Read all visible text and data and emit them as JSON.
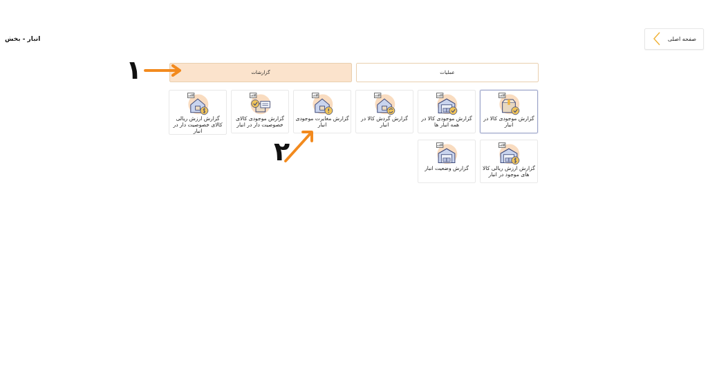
{
  "header": {
    "section_title": "انبار - بخش",
    "home_button": "صفحه اصلی"
  },
  "tabs": [
    {
      "label": "عملیات",
      "selected": false
    },
    {
      "label": "گزارشات",
      "selected": true
    }
  ],
  "tiles": [
    {
      "label": "گزارش موجودی کالا در انبار",
      "kind": "box-check",
      "selected": true
    },
    {
      "label": "گزارش موجودی کالا در همه انبار ها",
      "kind": "warehouse-check",
      "selected": false
    },
    {
      "label": "گزارش گردش کالا در انبار",
      "kind": "house-cycle",
      "selected": false
    },
    {
      "label": "گزارش مغایرت موجودی انبار",
      "kind": "house-alert",
      "selected": false
    },
    {
      "label": "گزارش موجودی کالای خصوصیت دار در انبار",
      "kind": "box-doc",
      "selected": false
    },
    {
      "label": "گزارش ارزش ریالی کالای خصوصیت دار در انبار",
      "kind": "house-dollar",
      "selected": false
    },
    {
      "label": "گزارش ارزش ریالی کالا های موجود در انبار",
      "kind": "warehouse-dollar",
      "selected": false
    },
    {
      "label": "گزارش وضعیت انبار",
      "kind": "warehouse",
      "selected": false
    }
  ],
  "annotations": [
    {
      "label": "۱",
      "kind": "tab-arrow"
    },
    {
      "label": "۲",
      "kind": "tile-arrow"
    }
  ]
}
